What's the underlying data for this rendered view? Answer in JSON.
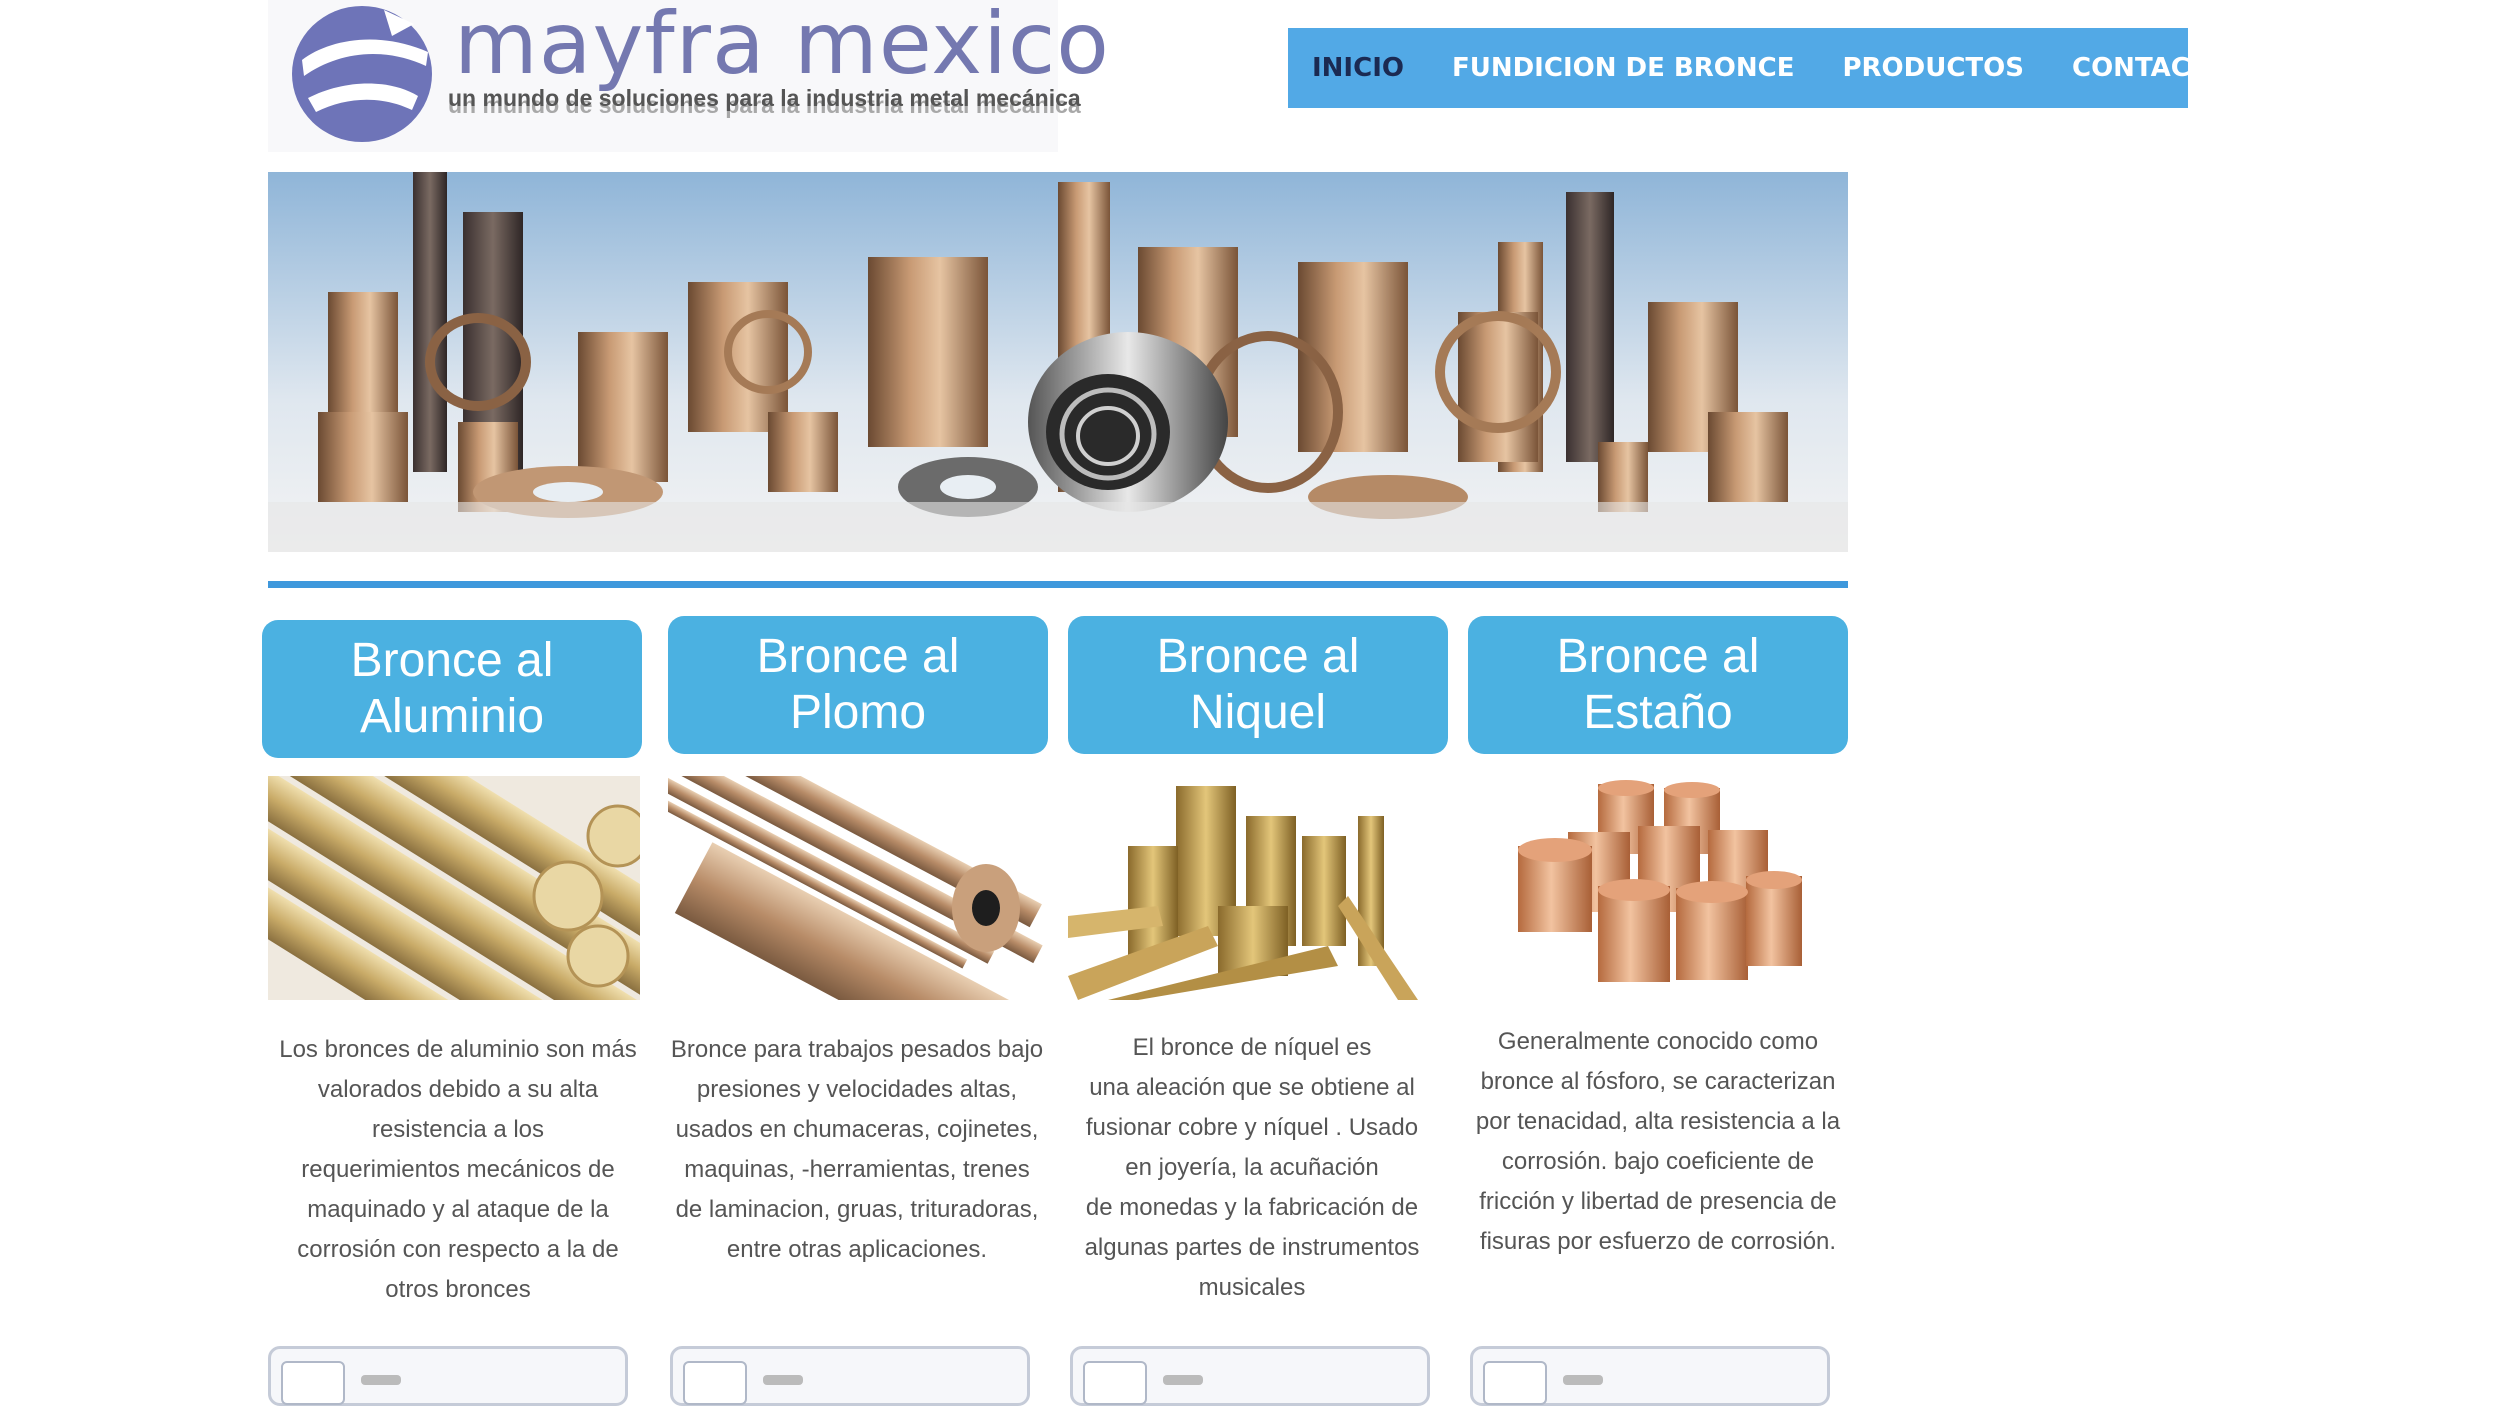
{
  "logo": {
    "name": "mayfra mexico",
    "tagline": "un mundo de soluciones para la industria metal mecánica"
  },
  "nav": {
    "items": [
      "INICIO",
      "FUNDICION DE BRONCE",
      "PRODUCTOS",
      "CONTACTO"
    ],
    "active": "INICIO"
  },
  "colors": {
    "nav_bg": "#52a9e6",
    "nav_active_text": "#1b2a52",
    "button_bg": "#4bb1e1",
    "divider": "#3e98dc",
    "body_text": "#555555"
  },
  "products": [
    {
      "title_line1": "Bronce al",
      "title_line2": "Aluminio",
      "desc": [
        "Los bronces de aluminio son más",
        "valorados debido a su alta",
        "resistencia a los",
        "requerimientos mecánicos de",
        "maquinado  y al ataque de  la",
        "corrosión con respecto a la de",
        "otros bronces"
      ]
    },
    {
      "title_line1": "Bronce al",
      "title_line2": "Plomo",
      "desc": [
        "Bronce para trabajos pesados bajo",
        "presiones y velocidades altas,",
        "usados en chumaceras,  cojinetes,",
        "maquinas, -herramientas, trenes",
        "de laminacion, gruas, trituradoras,",
        "entre otras aplicaciones."
      ]
    },
    {
      "title_line1": "Bronce al",
      "title_line2": "Niquel",
      "desc": [
        "El bronce de níquel es",
        "una aleación que se obtiene al",
        "fusionar cobre y níquel . Usado",
        "en joyería, la acuñación",
        "de monedas y la fabricación de",
        "algunas partes de instrumentos",
        "musicales"
      ]
    },
    {
      "title_line1": "Bronce al",
      "title_line2": "Estaño",
      "desc": [
        "Generalmente conocido como",
        "bronce al fósforo, se caracterizan",
        "por tenacidad, alta resistencia a la",
        "corrosión. bajo coeficiente de",
        "fricción y libertad de presencia de",
        "fisuras por esfuerzo de corrosión."
      ]
    }
  ]
}
